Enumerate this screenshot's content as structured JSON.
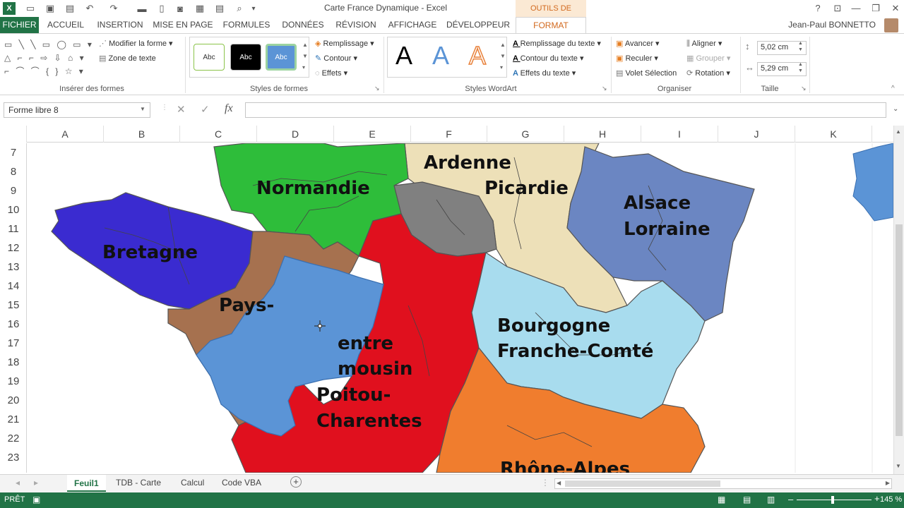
{
  "titlebar": {
    "title": "Carte France Dynamique - Excel",
    "context_tab": "OUTILS DE DESSIN",
    "buttons": {
      "help": "?",
      "ribbon_opts": "⊡",
      "minimize": "—",
      "restore": "❐",
      "close": "✕"
    }
  },
  "tabs": [
    "FICHIER",
    "ACCUEIL",
    "INSERTION",
    "MISE EN PAGE",
    "FORMULES",
    "DONNÉES",
    "RÉVISION",
    "AFFICHAGE",
    "DÉVELOPPEUR",
    "FORMAT"
  ],
  "user": "Jean-Paul BONNETTO",
  "ribbon": {
    "insert_shapes": {
      "label": "Insérer des formes",
      "edit_shape": "Modifier la forme",
      "text_box": "Zone de texte",
      "shape_glyphs": [
        "▭ ╲ ╲ ▭ ◯ ▭ ▾",
        "△ ⌐ ⌐ ⇨ ⇩ ⌂ ▾",
        "⌐ ⌒ ⌒ { } ☆ ▾"
      ]
    },
    "shape_styles": {
      "label": "Styles de formes",
      "samples": [
        "Abc",
        "Abc",
        "Abc"
      ],
      "fill": "Remplissage",
      "outline": "Contour",
      "effects": "Effets"
    },
    "wordart": {
      "label": "Styles WordArt",
      "letters": [
        "A",
        "A",
        "A"
      ],
      "text_fill": "Remplissage du texte",
      "text_outline": "Contour du texte",
      "text_effects": "Effets du texte"
    },
    "arrange": {
      "label": "Organiser",
      "forward": "Avancer",
      "backward": "Reculer",
      "selection_pane": "Volet Sélection",
      "align": "Aligner",
      "group": "Grouper",
      "rotate": "Rotation"
    },
    "size": {
      "label": "Taille",
      "height": "5,02 cm",
      "width": "5,29 cm"
    }
  },
  "formula_bar": {
    "name_box": "Forme libre 8",
    "cancel": "✕",
    "enter": "✓",
    "fx": "fx",
    "formula": ""
  },
  "columns": [
    "A",
    "B",
    "C",
    "D",
    "E",
    "F",
    "G",
    "H",
    "I",
    "J",
    "K"
  ],
  "rows": [
    "7",
    "8",
    "9",
    "10",
    "11",
    "12",
    "13",
    "14",
    "15",
    "16",
    "17",
    "18",
    "19",
    "20",
    "21",
    "22",
    "23"
  ],
  "map_labels": {
    "normandie": "Normandie",
    "ardenne": "Ardenne",
    "picardie": "Picardie",
    "alsace": "Alsace",
    "lorraine": "Lorraine",
    "bretagne": "Bretagne",
    "pays": "Pays-",
    "centre": "entre",
    "limousin": "mousin",
    "poitou": "Poitou-",
    "charentes": "Charentes",
    "bourgogne": "Bourgogne",
    "franche_comte": "Franche-Comté",
    "rhone_alpes": "Rhône-Alpes"
  },
  "map_colors": {
    "normandie": "#2ebd3a",
    "champagne": "#ede0b8",
    "idf": "#808080",
    "alsace": "#6b86c2",
    "bretagne": "#3a2bd0",
    "pays": "#a6714f",
    "selected": "#5b94d6",
    "centre": "#e0101e",
    "bourgogne": "#a8dcee",
    "rhone": "#f07d2e"
  },
  "sheets": [
    "Feuil1",
    "TDB - Carte",
    "Calcul",
    "Code VBA"
  ],
  "status": {
    "ready": "PRÊT",
    "zoom": "145 %"
  }
}
